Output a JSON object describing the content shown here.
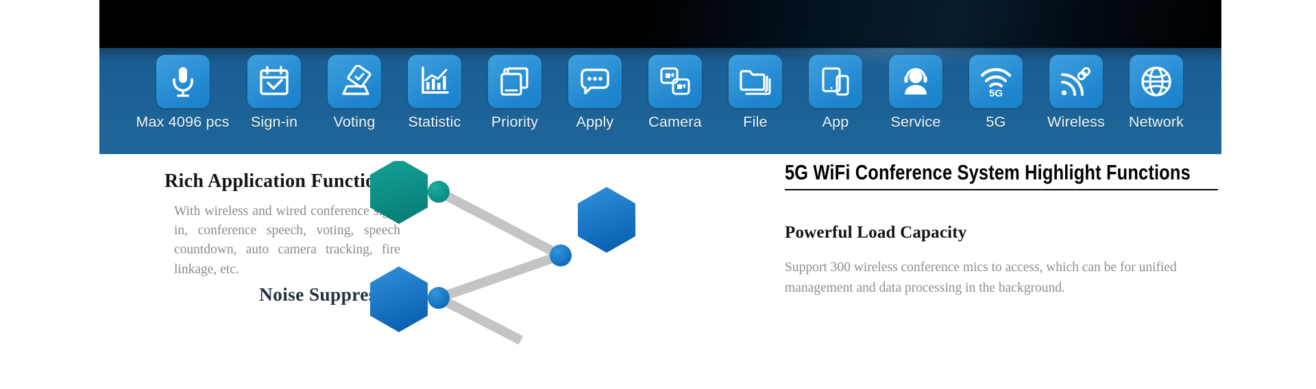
{
  "banner": {
    "tiles": [
      {
        "label": "Max 4096 pcs",
        "icon": "microphone-icon"
      },
      {
        "label": "Sign-in",
        "icon": "calendar-check-icon"
      },
      {
        "label": "Voting",
        "icon": "ballot-box-icon"
      },
      {
        "label": "Statistic",
        "icon": "bar-chart-icon"
      },
      {
        "label": "Priority",
        "icon": "stacked-cards-icon"
      },
      {
        "label": "Apply",
        "icon": "speech-bubble-icon"
      },
      {
        "label": "Camera",
        "icon": "dual-camera-icon"
      },
      {
        "label": "File",
        "icon": "folder-stack-icon"
      },
      {
        "label": "App",
        "icon": "tablet-phone-icon"
      },
      {
        "label": "Service",
        "icon": "headset-person-icon"
      },
      {
        "label": "5G",
        "icon": "wifi-5g-icon"
      },
      {
        "label": "Wireless",
        "icon": "wireless-link-icon"
      },
      {
        "label": "Network",
        "icon": "globe-icon"
      }
    ]
  },
  "left": {
    "heading": "Rich Application Functions",
    "body": "With wireless and wired conference sign-in, conference speech, voting, speech countdown, auto camera tracking, fire linkage, etc.",
    "secondary_heading": "Noise Suppression"
  },
  "right": {
    "title": "5G WiFi Conference System  Highlight Functions",
    "section_title": "Powerful Load Capacity",
    "section_body": "Support 300 wireless conference mics to access, which can be  for unified management and data processing in the background."
  },
  "diagram": {
    "colors": {
      "teal": "#0d9287",
      "blue": "#1170bf",
      "blue_light": "#2a8fd8",
      "line": "#c4c4c4"
    },
    "nodes": [
      {
        "name": "teal-hexagon",
        "shape": "hexagon",
        "color": "#0d9287"
      },
      {
        "name": "teal-dot",
        "shape": "circle",
        "color": "#0d9287"
      },
      {
        "name": "blue-hexagon-right",
        "shape": "hexagon",
        "color": "#1170bf"
      },
      {
        "name": "blue-dot-center",
        "shape": "circle",
        "color": "#1170bf"
      },
      {
        "name": "blue-hexagon-bottom",
        "shape": "hexagon",
        "color": "#1170bf"
      },
      {
        "name": "blue-dot-bottom",
        "shape": "circle",
        "color": "#1170bf"
      }
    ]
  },
  "theme": {
    "banner_blue": "#1d6297",
    "tile_blue": "#2f93d6",
    "banner_dark": "#000000",
    "body_gray": "#8b8b8b",
    "heading_dark": "#111417",
    "noise_navy": "#262f42"
  }
}
